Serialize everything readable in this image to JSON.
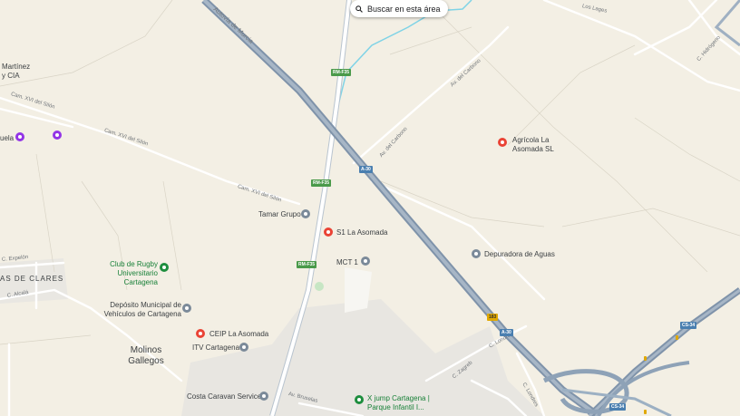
{
  "search_button": {
    "label": "Buscar en esta área",
    "icon": "search-icon"
  },
  "roads": {
    "autovia": "Autovía de Murcia",
    "cam_silon_1": "Cam. XVI del Silón",
    "cam_silon_2": "Cam. XVI del Silón",
    "cam_silon_3": "Cam. XVI del Silón",
    "av_carbono_1": "Av. del Carbono",
    "av_carbono_2": "Av. del Carbono",
    "los_lages": "Los Lages",
    "c_hidrogeno": "C. Hidrógeno",
    "c_expelon": "C. Expelón",
    "c_alcala": "C. Alcalá",
    "c_londres_1": "C. Londres",
    "c_londres_2": "C. Londres",
    "c_zagreb": "C. Zagreb",
    "av_bruselas": "Av. Bruselas"
  },
  "shields": {
    "rm_f35_top": "RM-F35",
    "rm_f35_mid": "RM-F35",
    "rm_f35_low": "RM-F35",
    "a30_1": "A-30",
    "a30_2": "A-30",
    "a30_3": "A-30",
    "cs34_1": "CS-34",
    "cs34_2": "CS-34",
    "exit_183": "183"
  },
  "pois": {
    "agricola": "Agrícola La Asomada SL",
    "tamar": "Tamar Grupo",
    "s1": "S1 La Asomada",
    "mct": "MCT 1",
    "depuradora": "Depuradora de Aguas",
    "rugby": "Club de Rugby Universitario Cartagena",
    "deposito": "Depósito Municipal de Vehículos de Cartagena",
    "ceip": "CEIP La Asomada",
    "itv": "ITV Cartagena",
    "costa": "Costa Caravan Service",
    "xjump": "X jump Cartagena | Parque Infantil I...",
    "martinez": "Martínez y CIA",
    "escuela": "uela"
  },
  "places": {
    "molinos": "Molinos Gallegos",
    "district": "AS DE CLARES"
  },
  "colors": {
    "land": "#f3efe4",
    "highway": "#8c9fb5",
    "road": "#ffffff",
    "water": "#7fd3e6",
    "industrial": "#e6e4e0"
  }
}
